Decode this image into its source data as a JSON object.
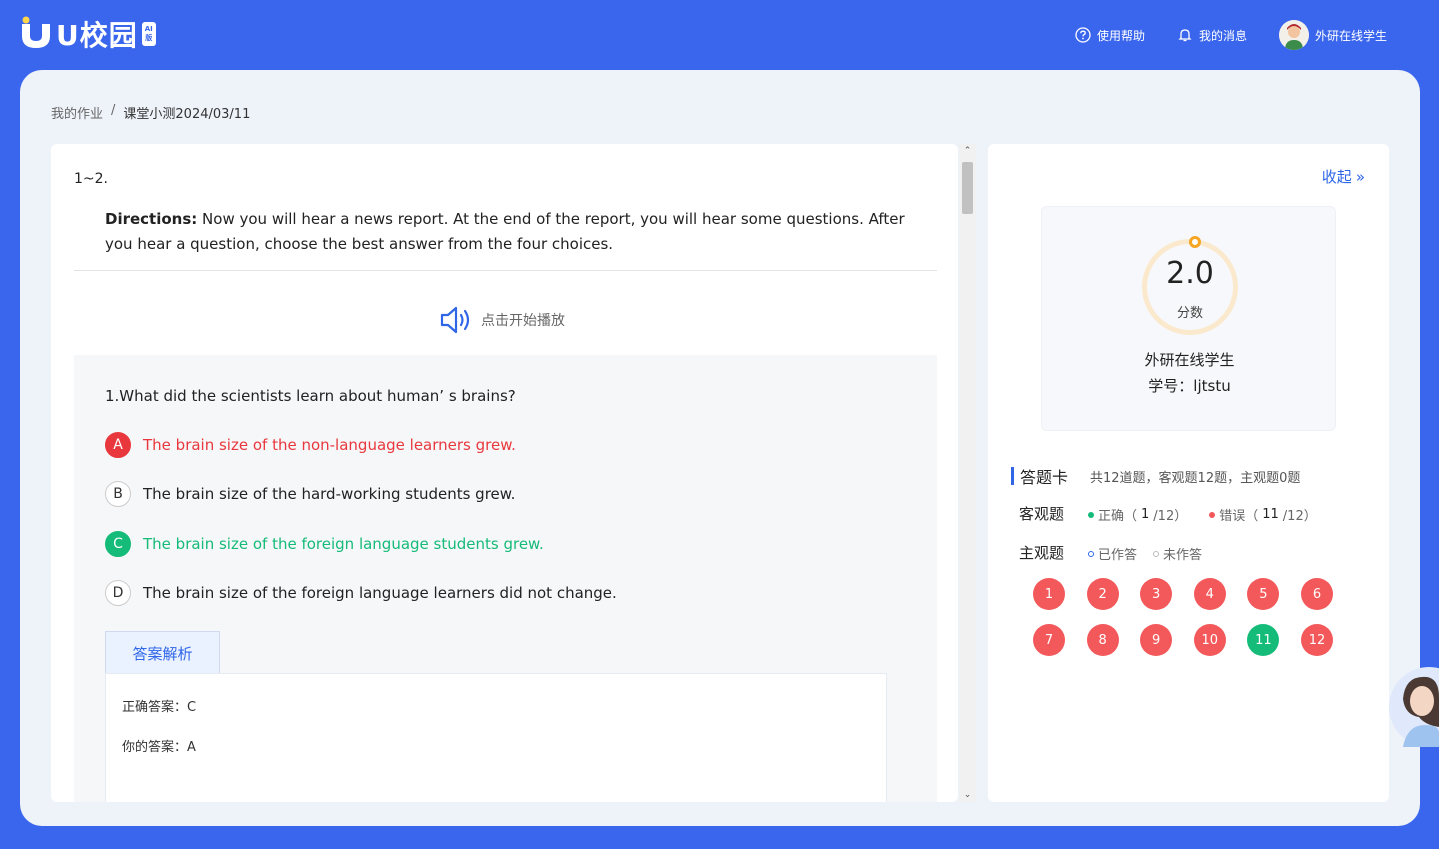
{
  "header": {
    "logo_text": "U校园",
    "logo_badge_1": "AI",
    "logo_badge_2": "版",
    "help_label": "使用帮助",
    "messages_label": "我的消息",
    "user_name": "外研在线学生"
  },
  "breadcrumb": {
    "parent": "我的作业",
    "separator": "/",
    "current": "课堂小测2024/03/11"
  },
  "question_panel": {
    "range": "1~2.",
    "directions_label": "Directions:",
    "directions_text": " Now you will hear a news report. At the end of the report, you will hear some questions. After you hear a question, choose the best answer from the four choices.",
    "play_label": "点击开始播放",
    "question": "1.What did the scientists learn about human’ s brains?",
    "options": [
      {
        "key": "A",
        "text": "The brain size of the non-language learners grew.",
        "state": "wrong"
      },
      {
        "key": "B",
        "text": "The brain size of the hard-working students grew.",
        "state": "none"
      },
      {
        "key": "C",
        "text": "The brain size of the foreign language students grew.",
        "state": "correct"
      },
      {
        "key": "D",
        "text": "The brain size of the foreign language learners did not change.",
        "state": "none"
      }
    ],
    "analysis_tab": "答案解析",
    "correct_answer_label": "正确答案：C",
    "your_answer_label": "你的答案：A"
  },
  "side_panel": {
    "collapse_label": "收起",
    "collapse_icon": "»",
    "score": "2.0",
    "score_label": "分数",
    "student_name": "外研在线学生",
    "student_id": "学号：ljtstu",
    "answer_card_title": "答题卡",
    "answer_card_summary": "共12道题，客观题12题，主观题0题",
    "objective_label": "客观题",
    "correct_label": "正确（",
    "correct_count": "1",
    "correct_total": "/12）",
    "wrong_label": "错误（",
    "wrong_count": "11",
    "wrong_total": "/12）",
    "subjective_label": "主观题",
    "answered_label": "已作答",
    "unanswered_label": "未作答",
    "questions": [
      {
        "n": "1",
        "ok": false
      },
      {
        "n": "2",
        "ok": false
      },
      {
        "n": "3",
        "ok": false
      },
      {
        "n": "4",
        "ok": false
      },
      {
        "n": "5",
        "ok": false
      },
      {
        "n": "6",
        "ok": false
      },
      {
        "n": "7",
        "ok": false
      },
      {
        "n": "8",
        "ok": false
      },
      {
        "n": "9",
        "ok": false
      },
      {
        "n": "10",
        "ok": false
      },
      {
        "n": "11",
        "ok": true
      },
      {
        "n": "12",
        "ok": false
      }
    ]
  },
  "colors": {
    "brand": "#3a66ee",
    "correct": "#15bb79",
    "wrong": "#e8383d"
  }
}
